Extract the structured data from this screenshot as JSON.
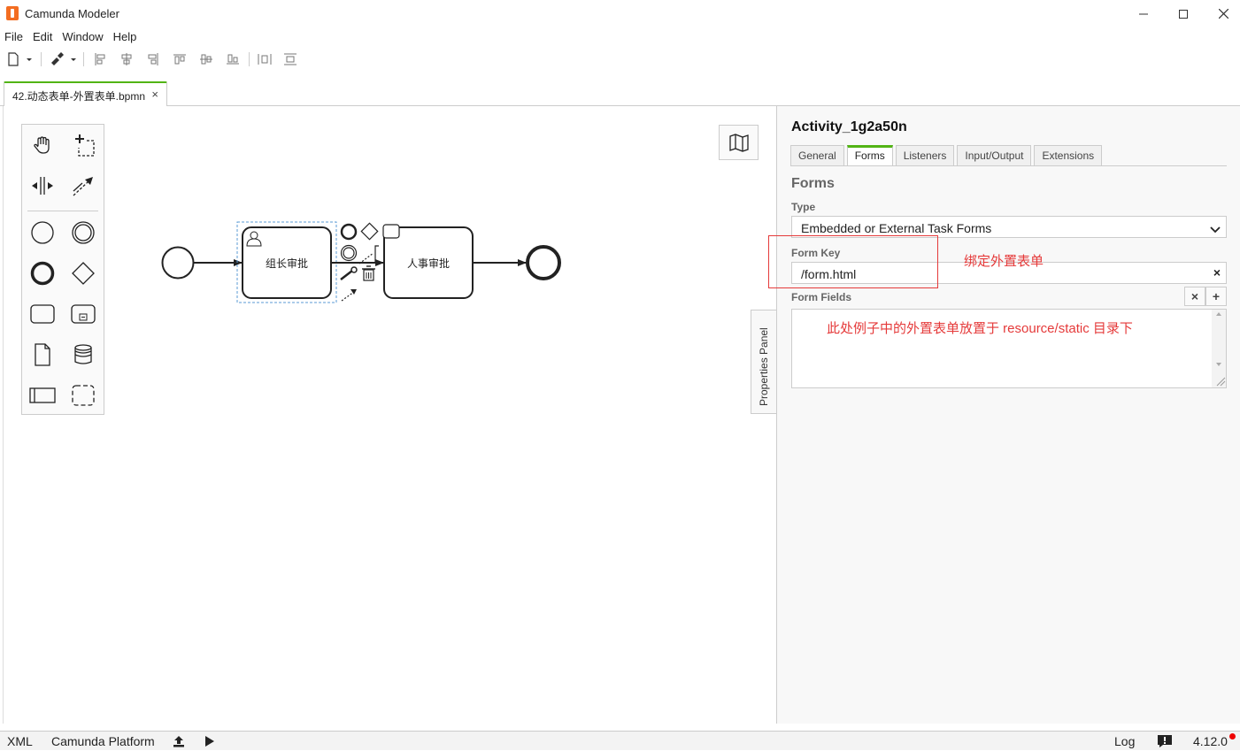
{
  "window": {
    "title": "Camunda Modeler"
  },
  "menu": {
    "items": [
      "File",
      "Edit",
      "Window",
      "Help"
    ]
  },
  "tab": {
    "label": "42.动态表单-外置表单.bpmn",
    "close": "×"
  },
  "diagram": {
    "task1_label": "组长审批",
    "task2_label": "人事审批"
  },
  "properties_toggle": "Properties Panel",
  "properties": {
    "title": "Activity_1g2a50n",
    "tabs": [
      "General",
      "Forms",
      "Listeners",
      "Input/Output",
      "Extensions"
    ],
    "active_tab": "Forms",
    "group_title": "Forms",
    "type_label": "Type",
    "type_value": "Embedded or External Task Forms",
    "form_key_label": "Form Key",
    "form_key_value": "/form.html",
    "clear_symbol": "×",
    "form_fields_label": "Form Fields",
    "remove_symbol": "×",
    "add_symbol": "+"
  },
  "annotations": {
    "bind_form": "绑定外置表单",
    "note": "此处例子中的外置表单放置于 resource/static 目录下"
  },
  "status": {
    "xml": "XML",
    "platform": "Camunda Platform",
    "log": "Log",
    "version": "4.12.0"
  },
  "colors": {
    "accent": "#52b415",
    "annotation": "#e53a3a",
    "app_icon": "#f36d21"
  }
}
